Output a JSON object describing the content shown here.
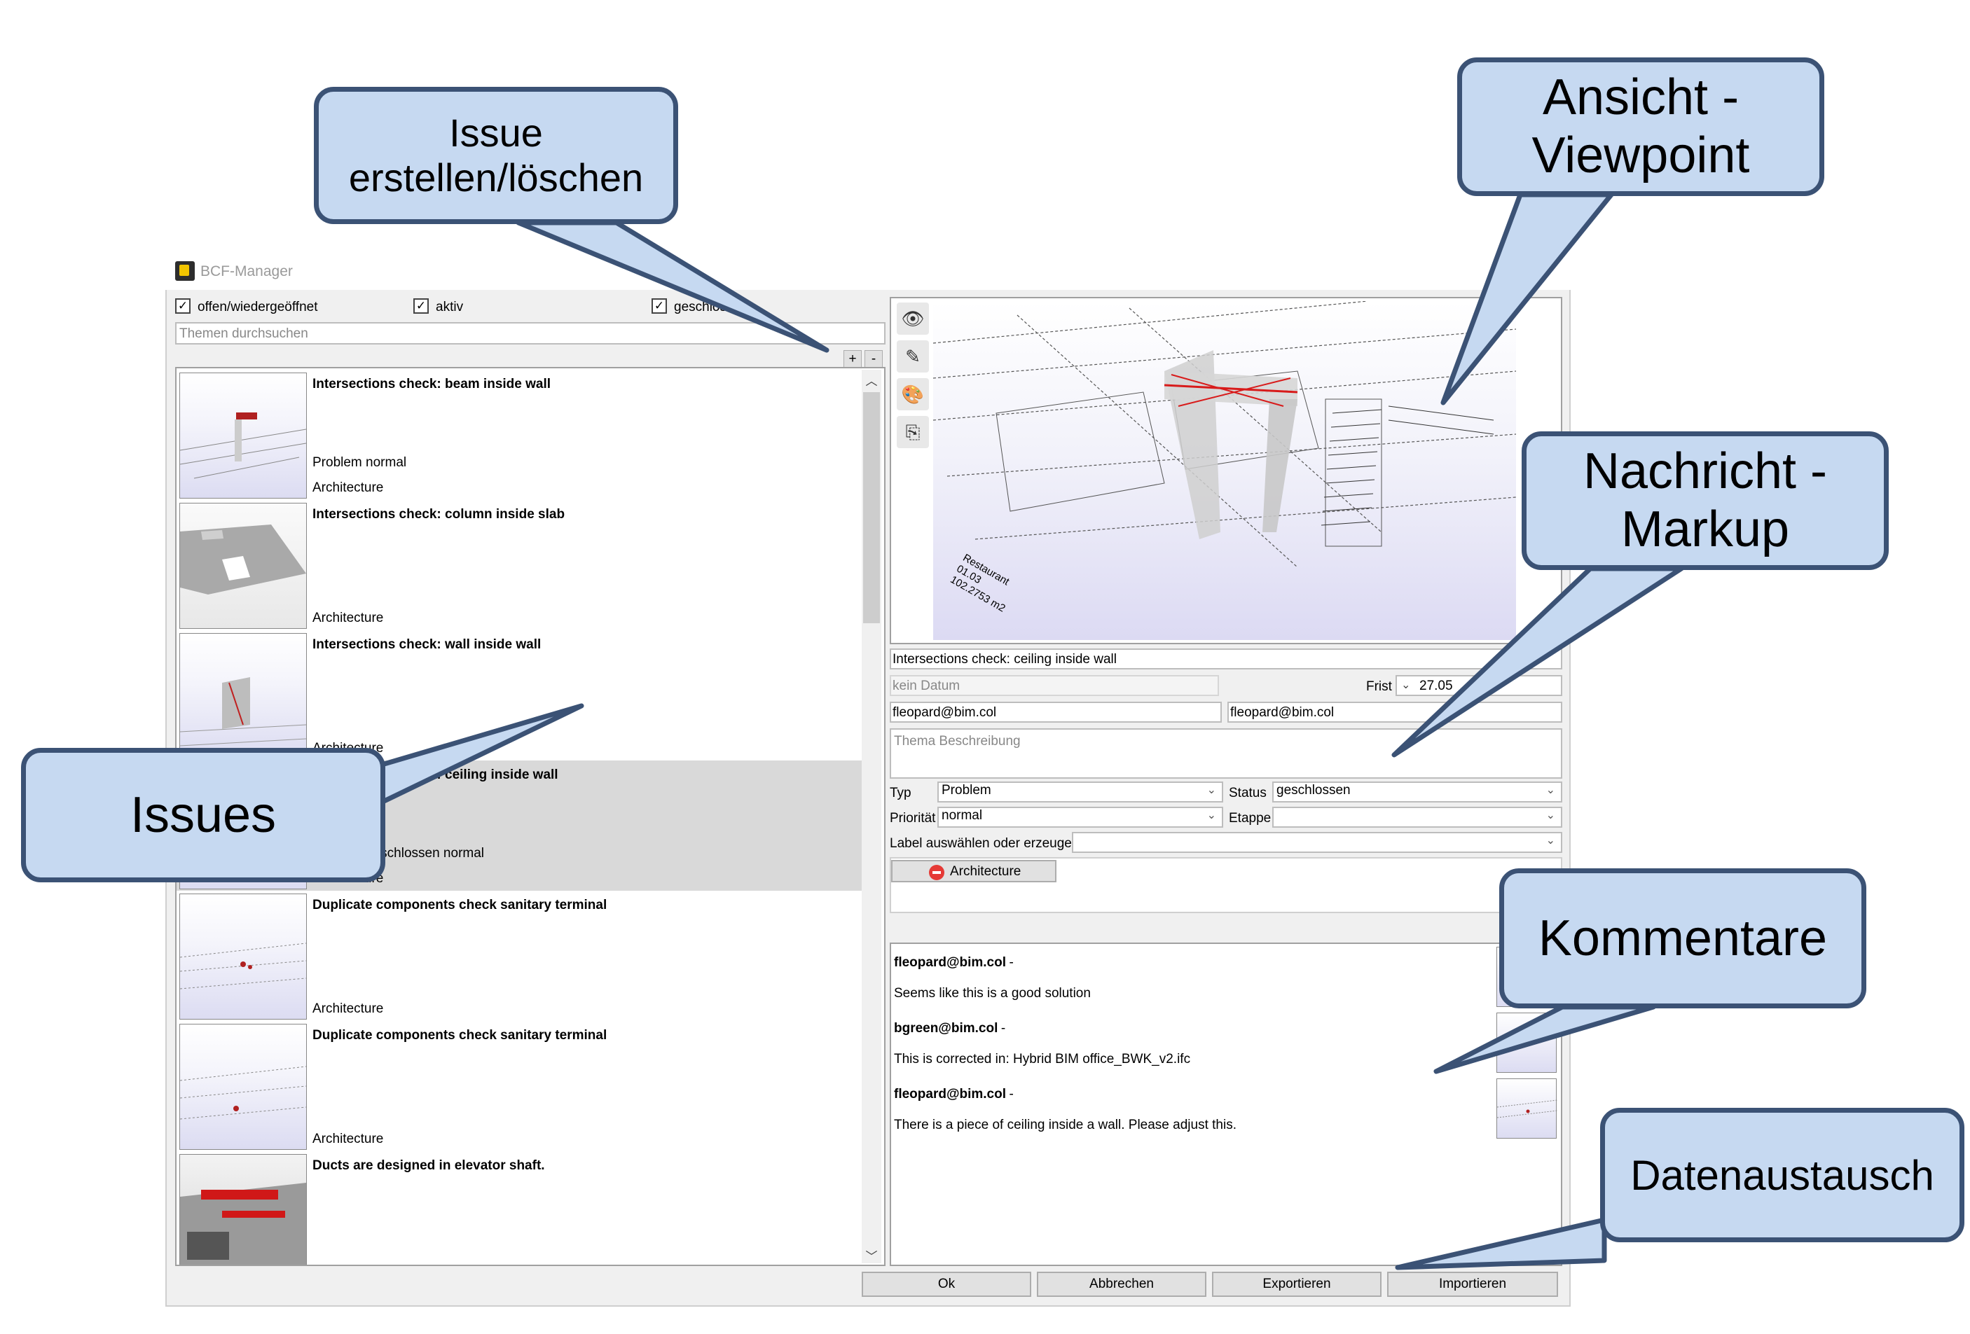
{
  "window": {
    "title": "BCF-Manager"
  },
  "filters": [
    {
      "label": "offen/wiedergeöffnet",
      "checked": true
    },
    {
      "label": "aktiv",
      "checked": true
    },
    {
      "label": "geschlossen",
      "checked": true
    }
  ],
  "search": {
    "placeholder": "Themen durchsuchen"
  },
  "list_buttons": {
    "add": "+",
    "remove": "-"
  },
  "issues": [
    {
      "title": "Intersections check: beam inside wall",
      "status": "Problem normal",
      "label": "Architecture",
      "selected": false
    },
    {
      "title": "Intersections check: column inside slab",
      "status": "",
      "label": "Architecture",
      "selected": false
    },
    {
      "title": "Intersections check: wall inside wall",
      "status": "",
      "label": "Architecture",
      "selected": false
    },
    {
      "title": "Intersections check: ceiling inside wall",
      "status": "Problem geschlossen normal",
      "label": "Architecture",
      "selected": true
    },
    {
      "title": "Duplicate components check sanitary terminal",
      "status": "",
      "label": "Architecture",
      "selected": false
    },
    {
      "title": "Duplicate components check sanitary terminal",
      "status": "",
      "label": "Architecture",
      "selected": false
    },
    {
      "title": "Ducts are designed in elevator shaft.",
      "status": "",
      "label": "",
      "selected": false
    }
  ],
  "viewpoint_tools": [
    {
      "name": "eye-icon",
      "glyph": "👁"
    },
    {
      "name": "edit-icon",
      "glyph": "✎"
    },
    {
      "name": "palette-icon",
      "glyph": "🎨"
    },
    {
      "name": "export-view-icon",
      "glyph": "⎘"
    }
  ],
  "viewpoint_text": {
    "room_name": "Restaurant",
    "room_number": "01.03",
    "room_area": "102.2753 m2"
  },
  "detail": {
    "title_value": "Intersections check: ceiling inside wall",
    "date_placeholder": "kein Datum",
    "deadline_label": "Frist",
    "deadline_value": "27.05",
    "author": "fleopard@bim.col",
    "assignee": "fleopard@bim.col",
    "description_placeholder": "Thema Beschreibung",
    "type_label": "Typ",
    "type_value": "Problem",
    "status_label": "Status",
    "status_value": "geschlossen",
    "priority_label": "Priorität",
    "priority_value": "normal",
    "stage_label": "Etappe",
    "stage_value": "",
    "tag_select_label": "Label auswählen oder erzeugen",
    "tag": "Architecture"
  },
  "comments": [
    {
      "author": "fleopard@bim.col",
      "separator": "-",
      "text": "Seems like this is a good solution"
    },
    {
      "author": "bgreen@bim.col",
      "separator": "-",
      "text": "This is corrected in: Hybrid BIM office_BWK_v2.ifc"
    },
    {
      "author": "fleopard@bim.col",
      "separator": "-",
      "text": "There is a piece of ceiling inside a wall. Please adjust this."
    }
  ],
  "buttons": {
    "ok": "Ok",
    "cancel": "Abbrechen",
    "export": "Exportieren",
    "import": "Importieren"
  },
  "callouts": {
    "create_delete": [
      "Issue",
      "erstellen/löschen"
    ],
    "viewpoint": [
      "Ansicht -",
      "Viewpoint"
    ],
    "markup": [
      "Nachricht -",
      "Markup"
    ],
    "issues": [
      "Issues"
    ],
    "comments": [
      "Kommentare"
    ],
    "exchange": [
      "Datenaustausch"
    ]
  },
  "colors": {
    "callout_fill": "#c6d9f1",
    "callout_border": "#3b5275",
    "selected_row": "#d9d9d9",
    "error_red": "#e53935"
  }
}
